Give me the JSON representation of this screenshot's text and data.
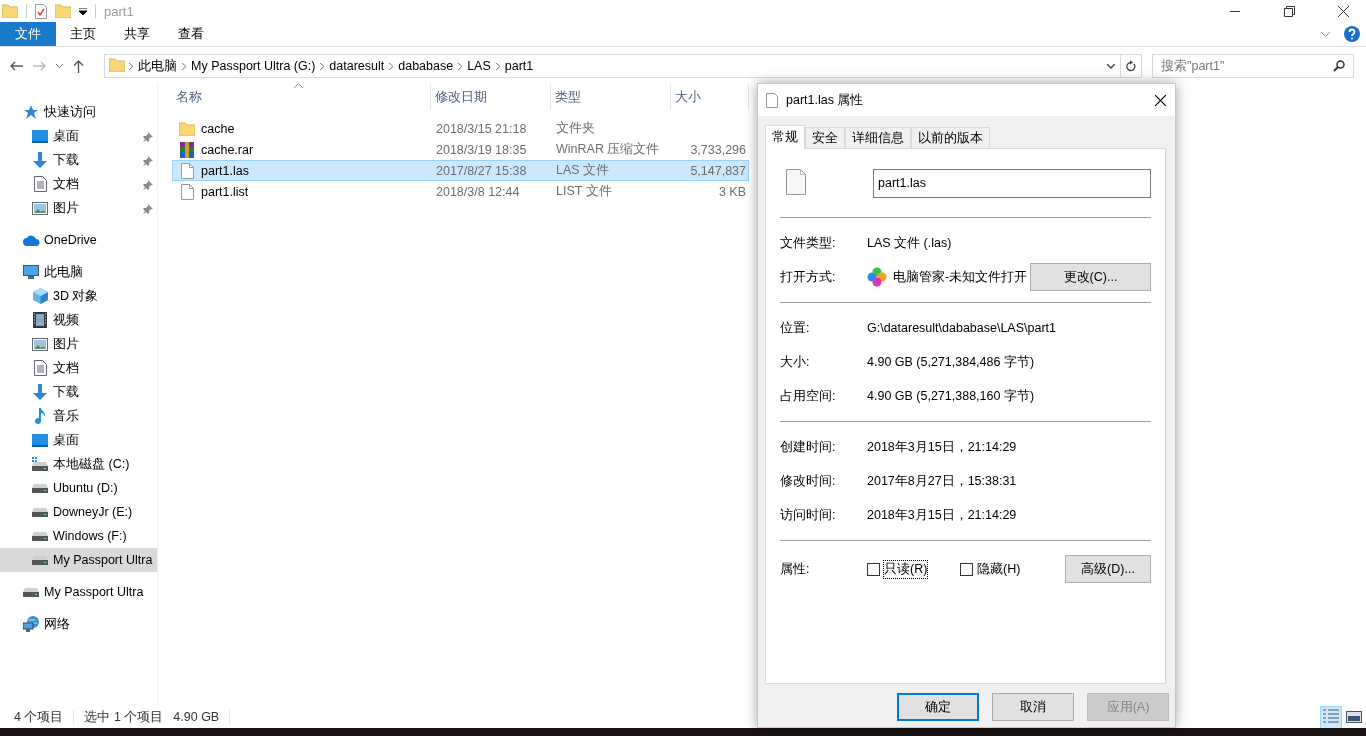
{
  "window": {
    "title": "part1"
  },
  "ribbon": {
    "tabs": [
      {
        "label": "文件",
        "kind": "file"
      },
      {
        "label": "主页",
        "kind": "tab"
      },
      {
        "label": "共享",
        "kind": "tab"
      },
      {
        "label": "查看",
        "kind": "tab"
      }
    ]
  },
  "address_bar": {
    "crumbs": [
      "此电脑",
      "My Passport Ultra (G:)",
      "dataresult",
      "dababase",
      "LAS",
      "part1"
    ]
  },
  "search": {
    "placeholder": "搜索\"part1\""
  },
  "sidebar": {
    "items": [
      {
        "label": "快速访问",
        "kind": "star",
        "selected": false,
        "children": [
          {
            "label": "桌面",
            "kind": "desktop",
            "pinned": true,
            "selected": false
          },
          {
            "label": "下载",
            "kind": "download",
            "pinned": true,
            "selected": false
          },
          {
            "label": "文档",
            "kind": "document",
            "pinned": true,
            "selected": false
          },
          {
            "label": "图片",
            "kind": "picture",
            "pinned": true,
            "selected": false
          }
        ]
      },
      {
        "label": "OneDrive",
        "kind": "cloud",
        "selected": false
      },
      {
        "label": "此电脑",
        "kind": "pc",
        "selected": false,
        "children": [
          {
            "label": "3D 对象",
            "kind": "cube",
            "selected": false
          },
          {
            "label": "视频",
            "kind": "video",
            "selected": false
          },
          {
            "label": "图片",
            "kind": "picture",
            "selected": false
          },
          {
            "label": "文档",
            "kind": "document",
            "selected": false
          },
          {
            "label": "下载",
            "kind": "download",
            "selected": false
          },
          {
            "label": "音乐",
            "kind": "music",
            "selected": false
          },
          {
            "label": "桌面",
            "kind": "desktop",
            "selected": false
          },
          {
            "label": "本地磁盘 (C:)",
            "kind": "system-drive",
            "selected": false
          },
          {
            "label": "Ubuntu (D:)",
            "kind": "drive",
            "selected": false
          },
          {
            "label": "DowneyJr (E:)",
            "kind": "drive",
            "selected": false
          },
          {
            "label": "Windows (F:)",
            "kind": "drive",
            "selected": false
          },
          {
            "label": "My Passport Ultra",
            "kind": "drive",
            "selected": true
          }
        ]
      },
      {
        "label": "My Passport Ultra",
        "kind": "drive",
        "selected": false
      },
      {
        "label": "网络",
        "kind": "network",
        "selected": false
      }
    ]
  },
  "file_list": {
    "columns": [
      "名称",
      "修改日期",
      "类型",
      "大小"
    ],
    "rows": [
      {
        "name": "cache",
        "modified": "2018/3/15 21:18",
        "type": "文件夹",
        "size": "",
        "kind": "folder",
        "selected": false
      },
      {
        "name": "cache.rar",
        "modified": "2018/3/19 18:35",
        "type": "WinRAR 压缩文件",
        "size": "3,733,296",
        "kind": "archive",
        "selected": false
      },
      {
        "name": "part1.las",
        "modified": "2017/8/27 15:38",
        "type": "LAS 文件",
        "size": "5,147,837",
        "kind": "file",
        "selected": true
      },
      {
        "name": "part1.list",
        "modified": "2018/3/8 12:44",
        "type": "LIST 文件",
        "size": "3 KB",
        "kind": "file",
        "selected": false
      }
    ]
  },
  "status_bar": {
    "item_count": "4 个项目",
    "selection": "选中 1 个项目",
    "selection_size": "4.90 GB"
  },
  "dialog": {
    "title": "part1.las 属性",
    "tabs": [
      {
        "label": "常规",
        "selected": true
      },
      {
        "label": "安全",
        "selected": false
      },
      {
        "label": "详细信息",
        "selected": false
      },
      {
        "label": "以前的版本",
        "selected": false
      }
    ],
    "file_name": "part1.las",
    "file_type": {
      "label": "文件类型:",
      "value": "LAS 文件 (.las)"
    },
    "open_with": {
      "label": "打开方式:",
      "app": "电脑管家-未知文件打开",
      "button": "更改(C)..."
    },
    "location_rows": [
      {
        "label": "位置:",
        "value": "G:\\dataresult\\dababase\\LAS\\part1"
      },
      {
        "label": "大小:",
        "value": "4.90 GB (5,271,384,486 字节)"
      },
      {
        "label": "占用空间:",
        "value": "4.90 GB (5,271,388,160 字节)"
      }
    ],
    "time_rows": [
      {
        "label": "创建时间:",
        "value": "2018年3月15日，21:14:29"
      },
      {
        "label": "修改时间:",
        "value": "2017年8月27日，15:38:31"
      },
      {
        "label": "访问时间:",
        "value": "2018年3月15日，21:14:29"
      }
    ],
    "attributes": {
      "label": "属性:",
      "options": [
        {
          "label": "只读(R)",
          "checked": false,
          "focused": true
        },
        {
          "label": "隐藏(H)",
          "checked": false,
          "focused": false
        }
      ],
      "button": "高级(D)..."
    },
    "buttons": [
      {
        "label": "确定",
        "default": true,
        "disabled": false
      },
      {
        "label": "取消",
        "default": false,
        "disabled": false
      },
      {
        "label": "应用(A)",
        "default": false,
        "disabled": true
      }
    ]
  }
}
